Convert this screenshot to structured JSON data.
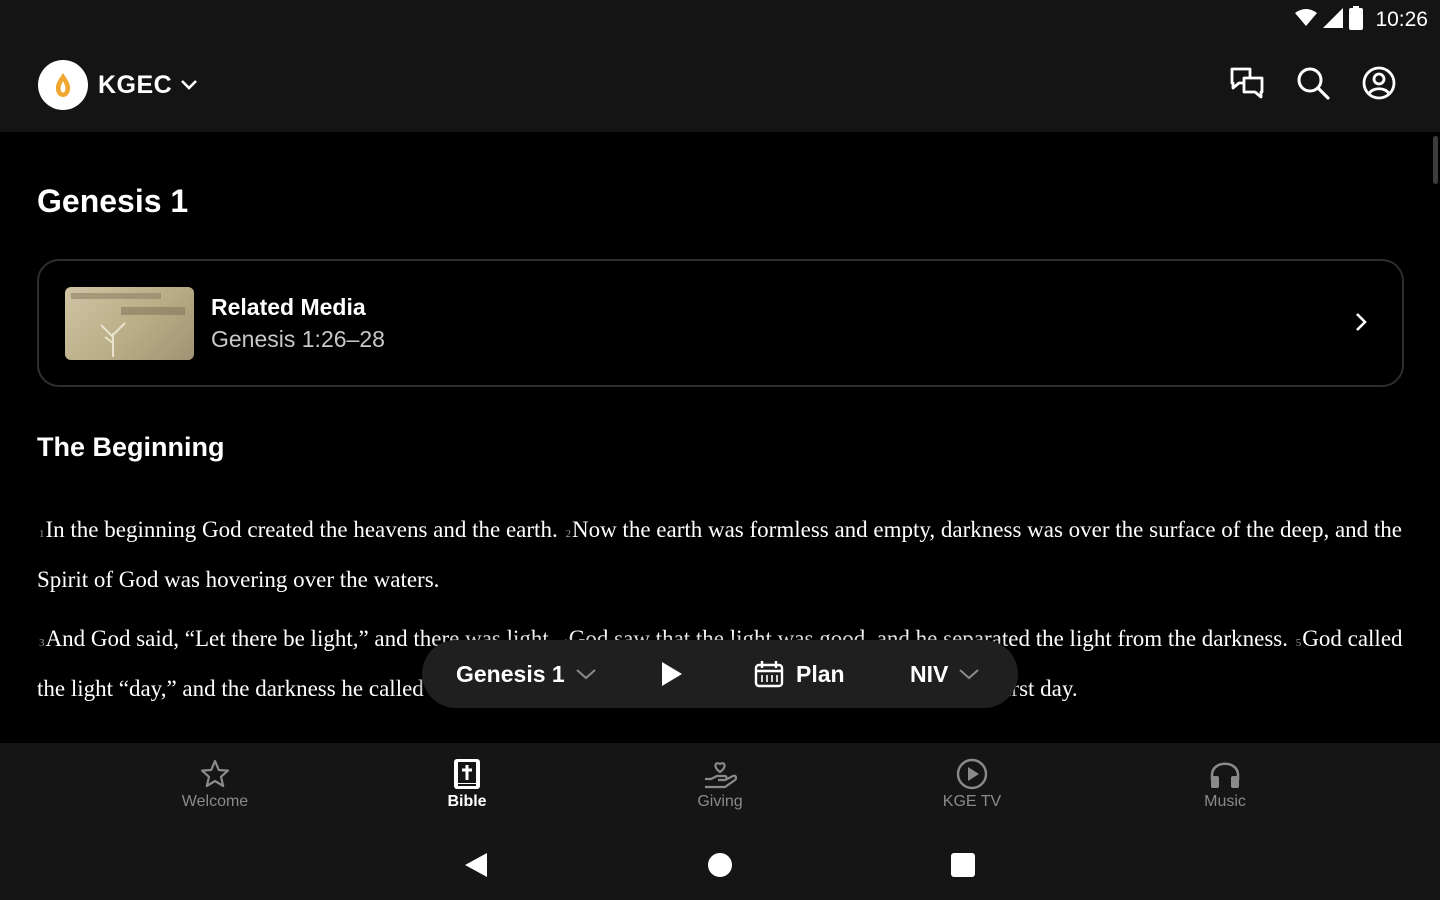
{
  "status_bar": {
    "time": "10:26"
  },
  "header": {
    "org_name": "KGEC",
    "icons": [
      "chat-icon",
      "search-icon",
      "account-icon"
    ]
  },
  "chapter_title": "Genesis 1",
  "related_media": {
    "title": "Related Media",
    "reference": "Genesis 1:26–28"
  },
  "section_heading": "The Beginning",
  "scripture": {
    "p1": {
      "v1_num": "1",
      "v1": "In the beginning God created the heavens and the earth.",
      "v2_num": "2",
      "v2": "Now the earth was formless and empty, darkness was over the surface of the deep, and the Spirit of God was hovering over the waters."
    },
    "p2": {
      "v3_num": "3",
      "v3": "And God said, “Let there be light,” and there was light.",
      "v4_num": "4",
      "v4": "God saw that the light was good, and he separated the light from the darkness.",
      "v5_num": "5",
      "v5": "God called the light “day,” and the darkness he called “night.” And there was evening, and there was morning—the first day."
    }
  },
  "reader_toolbar": {
    "chapter": "Genesis 1",
    "plan": "Plan",
    "version": "NIV"
  },
  "bottom_nav": {
    "active": "Bible",
    "items": [
      {
        "label": "Welcome",
        "icon": "star-icon"
      },
      {
        "label": "Bible",
        "icon": "bible-icon"
      },
      {
        "label": "Giving",
        "icon": "giving-icon"
      },
      {
        "label": "KGE TV",
        "icon": "play-circle-icon"
      },
      {
        "label": "Music",
        "icon": "headphones-icon"
      }
    ]
  },
  "colors": {
    "background": "#000000",
    "bar": "#141414",
    "muted": "#8a8a8a"
  }
}
